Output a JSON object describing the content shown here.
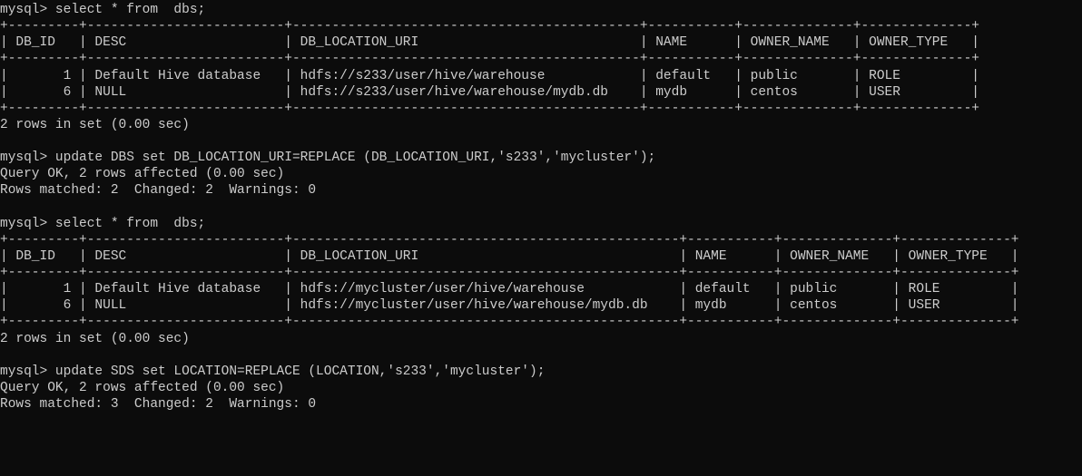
{
  "prompt": "mysql> ",
  "queries": {
    "q1": "select * from  dbs;",
    "q2": "update DBS set DB_LOCATION_URI=REPLACE (DB_LOCATION_URI,'s233','mycluster');",
    "q3": "select * from  dbs;",
    "q4": "update SDS set LOCATION=REPLACE (LOCATION,'s233','mycluster');"
  },
  "table1": {
    "columns": [
      "DB_ID",
      "DESC",
      "DB_LOCATION_URI",
      "NAME",
      "OWNER_NAME",
      "OWNER_TYPE"
    ],
    "widths": [
      7,
      23,
      42,
      9,
      12,
      12
    ],
    "rows": [
      {
        "DB_ID": "1",
        "DESC": "Default Hive database",
        "DB_LOCATION_URI": "hdfs://s233/user/hive/warehouse",
        "NAME": "default",
        "OWNER_NAME": "public",
        "OWNER_TYPE": "ROLE"
      },
      {
        "DB_ID": "6",
        "DESC": "NULL",
        "DB_LOCATION_URI": "hdfs://s233/user/hive/warehouse/mydb.db",
        "NAME": "mydb",
        "OWNER_NAME": "centos",
        "OWNER_TYPE": "USER"
      }
    ],
    "footer": "2 rows in set (0.00 sec)"
  },
  "result2": {
    "line1": "Query OK, 2 rows affected (0.00 sec)",
    "line2": "Rows matched: 2  Changed: 2  Warnings: 0"
  },
  "table3": {
    "columns": [
      "DB_ID",
      "DESC",
      "DB_LOCATION_URI",
      "NAME",
      "OWNER_NAME",
      "OWNER_TYPE"
    ],
    "widths": [
      7,
      23,
      47,
      9,
      12,
      12
    ],
    "rows": [
      {
        "DB_ID": "1",
        "DESC": "Default Hive database",
        "DB_LOCATION_URI": "hdfs://mycluster/user/hive/warehouse",
        "NAME": "default",
        "OWNER_NAME": "public",
        "OWNER_TYPE": "ROLE"
      },
      {
        "DB_ID": "6",
        "DESC": "NULL",
        "DB_LOCATION_URI": "hdfs://mycluster/user/hive/warehouse/mydb.db",
        "NAME": "mydb",
        "OWNER_NAME": "centos",
        "OWNER_TYPE": "USER"
      }
    ],
    "footer": "2 rows in set (0.00 sec)"
  },
  "result4": {
    "line1": "Query OK, 2 rows affected (0.00 sec)",
    "line2": "Rows matched: 3  Changed: 2  Warnings: 0"
  },
  "right_align_cols": [
    "DB_ID"
  ]
}
